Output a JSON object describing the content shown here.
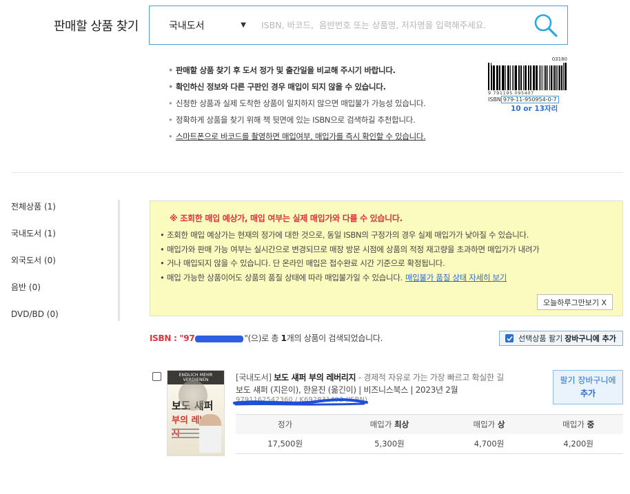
{
  "header": {
    "title": "판매할 상품 찾기",
    "category": "국내도서",
    "search_placeholder": "ISBN, 바코드,  음반번호 또는 상품명, 저자명을 입력해주세요."
  },
  "notices": [
    "판매할 상품 찾기 후 도서 정가 및 출간일을 비교해 주시기 바랍니다.",
    "확인하신 정보와 다른 구판인 경우 매입이 되지 않을 수 있습니다.",
    "신청한 상품과 실제 도착한 상품이 일치하지 않으면 매입불가 가능성 있습니다.",
    "정확하게 상품을 찾기 위해 책 뒷면에 있는 ISBN으로 검색하길 추천합니다.",
    "스마트폰으로 바코드를 촬영하면 매입여부, 매입가를 즉시 확인할 수 있습니다."
  ],
  "barcode": {
    "top_number": "03180",
    "digits": "9 791195 095407",
    "isbn_prefix": "ISBN",
    "isbn_value": "979-11-950954-0-7",
    "note": "10 or 13자리"
  },
  "sidebar": {
    "items": [
      {
        "label": "전체상품 (1)"
      },
      {
        "label": "국내도서 (1)"
      },
      {
        "label": "외국도서 (0)"
      },
      {
        "label": "음반 (0)"
      },
      {
        "label": "DVD/BD (0)"
      }
    ]
  },
  "notice_box": {
    "warning": "※ 조회한 매입 예상가, 매입 여부는 실제 매입가와 다를 수 있습니다.",
    "items": [
      "조회한 매입 예상가는 현재의 정가에 대한 것으로, 동일 ISBN의 구정가의 경우 실제 매입가가 낮아질 수 있습니다.",
      "매입가와 판매 가능 여부는 실시간으로 변경되므로 매장 방문 시점에 상품의 적정 재고량을 초과하면 매입가가 내려가",
      "거나 매입되지 않을 수 있습니다. 단 온라인 매입은 접수완료 시간 기준으로 확정됩니다.",
      "매입 가능한 상품이어도 상품의 품질 상태에 따라 매입불가일 수 있습니다."
    ],
    "link": "매입불가 품질 상태 자세히 보기",
    "close_label": "오늘하루그만보기 X"
  },
  "results": {
    "isbn_label": "ISBN : \"97",
    "suffix_1": "\"(으)로 총 ",
    "count": "1",
    "suffix_2": "개의 상품이 검색되었습니다.",
    "cart_all_prefix": "선택상품 팔기",
    "cart_all_bold": "장바구니에 추가"
  },
  "product": {
    "category": "[국내도서]",
    "title": "보도 섀퍼 부의 레버리지",
    "subtitle": "- 경제적 자유로 가는 가장 빠르고 확실한 길",
    "authors": "보도 섀퍼 (지은이), 한윤진 (옮긴이) | 비즈니스북스 | 2023년 2월",
    "isbn_hidden": "9791162542360 / K692831492 (ISBN)",
    "cover": {
      "top": "ENDLICH MEHR VERDIENEN",
      "title_1": "보도 섀퍼",
      "title_2": "부의 레버리지"
    },
    "cart_button_line1": "팔기 장바구니에",
    "cart_button_line2": "추가",
    "price_headers": [
      {
        "pre": "정가",
        "bold": ""
      },
      {
        "pre": "매입가 ",
        "bold": "최상"
      },
      {
        "pre": "매입가 ",
        "bold": "상"
      },
      {
        "pre": "매입가 ",
        "bold": "중"
      }
    ],
    "prices": [
      "17,500원",
      "5,300원",
      "4,700원",
      "4,200원"
    ]
  },
  "colors": {
    "accent_blue": "#2a6fd2",
    "warning_red": "#e0323b",
    "notice_bg": "#fbfabf",
    "search_border": "#4a9fd8"
  }
}
